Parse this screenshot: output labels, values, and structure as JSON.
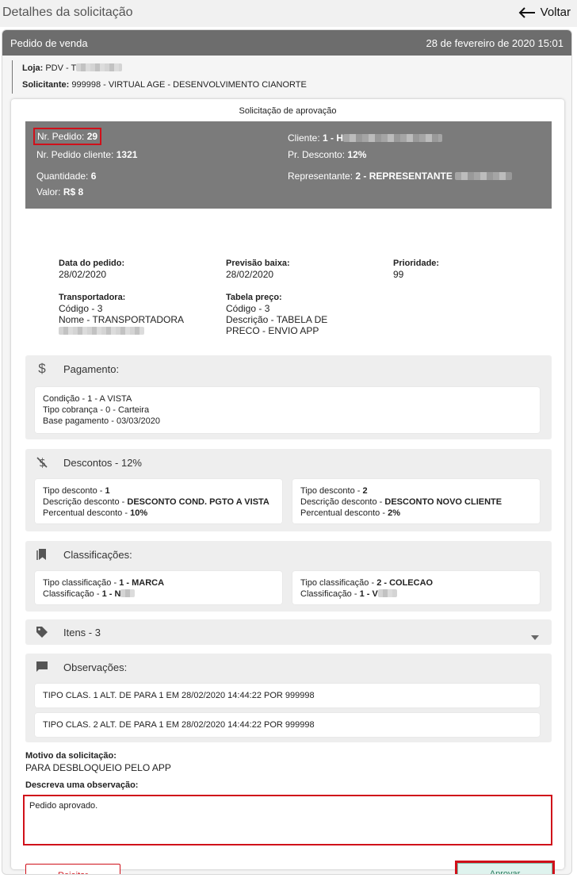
{
  "topbar": {
    "title": "Detalhes da solicitação",
    "back_label": "Voltar"
  },
  "header": {
    "type": "Pedido de venda",
    "datetime": "28 de fevereiro de 2020 15:01"
  },
  "info": {
    "loja_label": "Loja:",
    "loja_value": "PDV - T",
    "solicitante_label": "Solicitante:",
    "solicitante_value": "999998 - VIRTUAL AGE - DESENVOLVIMENTO CIANORTE"
  },
  "card": {
    "title": "Solicitação de aprovação"
  },
  "summary": {
    "nr_pedido_label": "Nr. Pedido:",
    "nr_pedido_value": "29",
    "nr_pedido_cliente_label": "Nr. Pedido cliente:",
    "nr_pedido_cliente_value": "1321",
    "quantidade_label": "Quantidade:",
    "quantidade_value": "6",
    "valor_label": "Valor:",
    "valor_value": "R$ 8",
    "cliente_label": "Cliente:",
    "cliente_value": "1 - H",
    "desconto_label": "Pr. Desconto:",
    "desconto_value": "12%",
    "representante_label": "Representante:",
    "representante_value": "2 - REPRESENTANTE"
  },
  "details": {
    "data_pedido_label": "Data do pedido:",
    "data_pedido_value": "28/02/2020",
    "previsao_label": "Previsão baixa:",
    "previsao_value": "28/02/2020",
    "prioridade_label": "Prioridade:",
    "prioridade_value": "99",
    "transportadora_label": "Transportadora:",
    "transportadora_codigo": "Código - 3",
    "transportadora_nome": "Nome - TRANSPORTADORA",
    "tabela_label": "Tabela preço:",
    "tabela_codigo": "Código - 3",
    "tabela_desc1": "Descrição - TABELA DE",
    "tabela_desc2": "PRECO - ENVIO APP"
  },
  "pagamento": {
    "title": "Pagamento:",
    "condicao": "Condição - 1 - A VISTA",
    "tipo_cobranca": "Tipo cobrança - 0 - Carteira",
    "base_pagamento": "Base pagamento - 03/03/2020"
  },
  "descontos": {
    "title": "Descontos - 12%",
    "items": [
      {
        "tipo_label": "Tipo desconto - ",
        "tipo_value": "1",
        "desc_label": "Descrição desconto - ",
        "desc_value": "DESCONTO COND. PGTO A VISTA",
        "perc_label": "Percentual desconto - ",
        "perc_value": "10%"
      },
      {
        "tipo_label": "Tipo desconto - ",
        "tipo_value": "2",
        "desc_label": "Descrição desconto - ",
        "desc_value": "DESCONTO NOVO CLIENTE",
        "perc_label": "Percentual desconto - ",
        "perc_value": "2%"
      }
    ]
  },
  "classificacoes": {
    "title": "Classificações:",
    "items": [
      {
        "tipo_label": "Tipo classificação - ",
        "tipo_value": "1 - MARCA",
        "class_label": "Classificação - ",
        "class_value": "1 - N"
      },
      {
        "tipo_label": "Tipo classificação - ",
        "tipo_value": "2 - COLECAO",
        "class_label": "Classificação - ",
        "class_value": "1 - V"
      }
    ]
  },
  "itens": {
    "title": "Itens - 3"
  },
  "observacoes": {
    "title": "Observações:",
    "items": [
      "TIPO CLAS. 1 ALT. DE PARA 1 EM 28/02/2020 14:44:22 POR 999998",
      "TIPO CLAS. 2 ALT. DE PARA 1 EM 28/02/2020 14:44:22 POR 999998"
    ]
  },
  "motivo": {
    "label": "Motivo da solicitação:",
    "value": "PARA DESBLOQUEIO PELO APP"
  },
  "observacao_input": {
    "label": "Descreva uma observação:",
    "value": "Pedido aprovado."
  },
  "actions": {
    "reject_label": "Rejeitar",
    "approve_label": "Aprovar"
  }
}
